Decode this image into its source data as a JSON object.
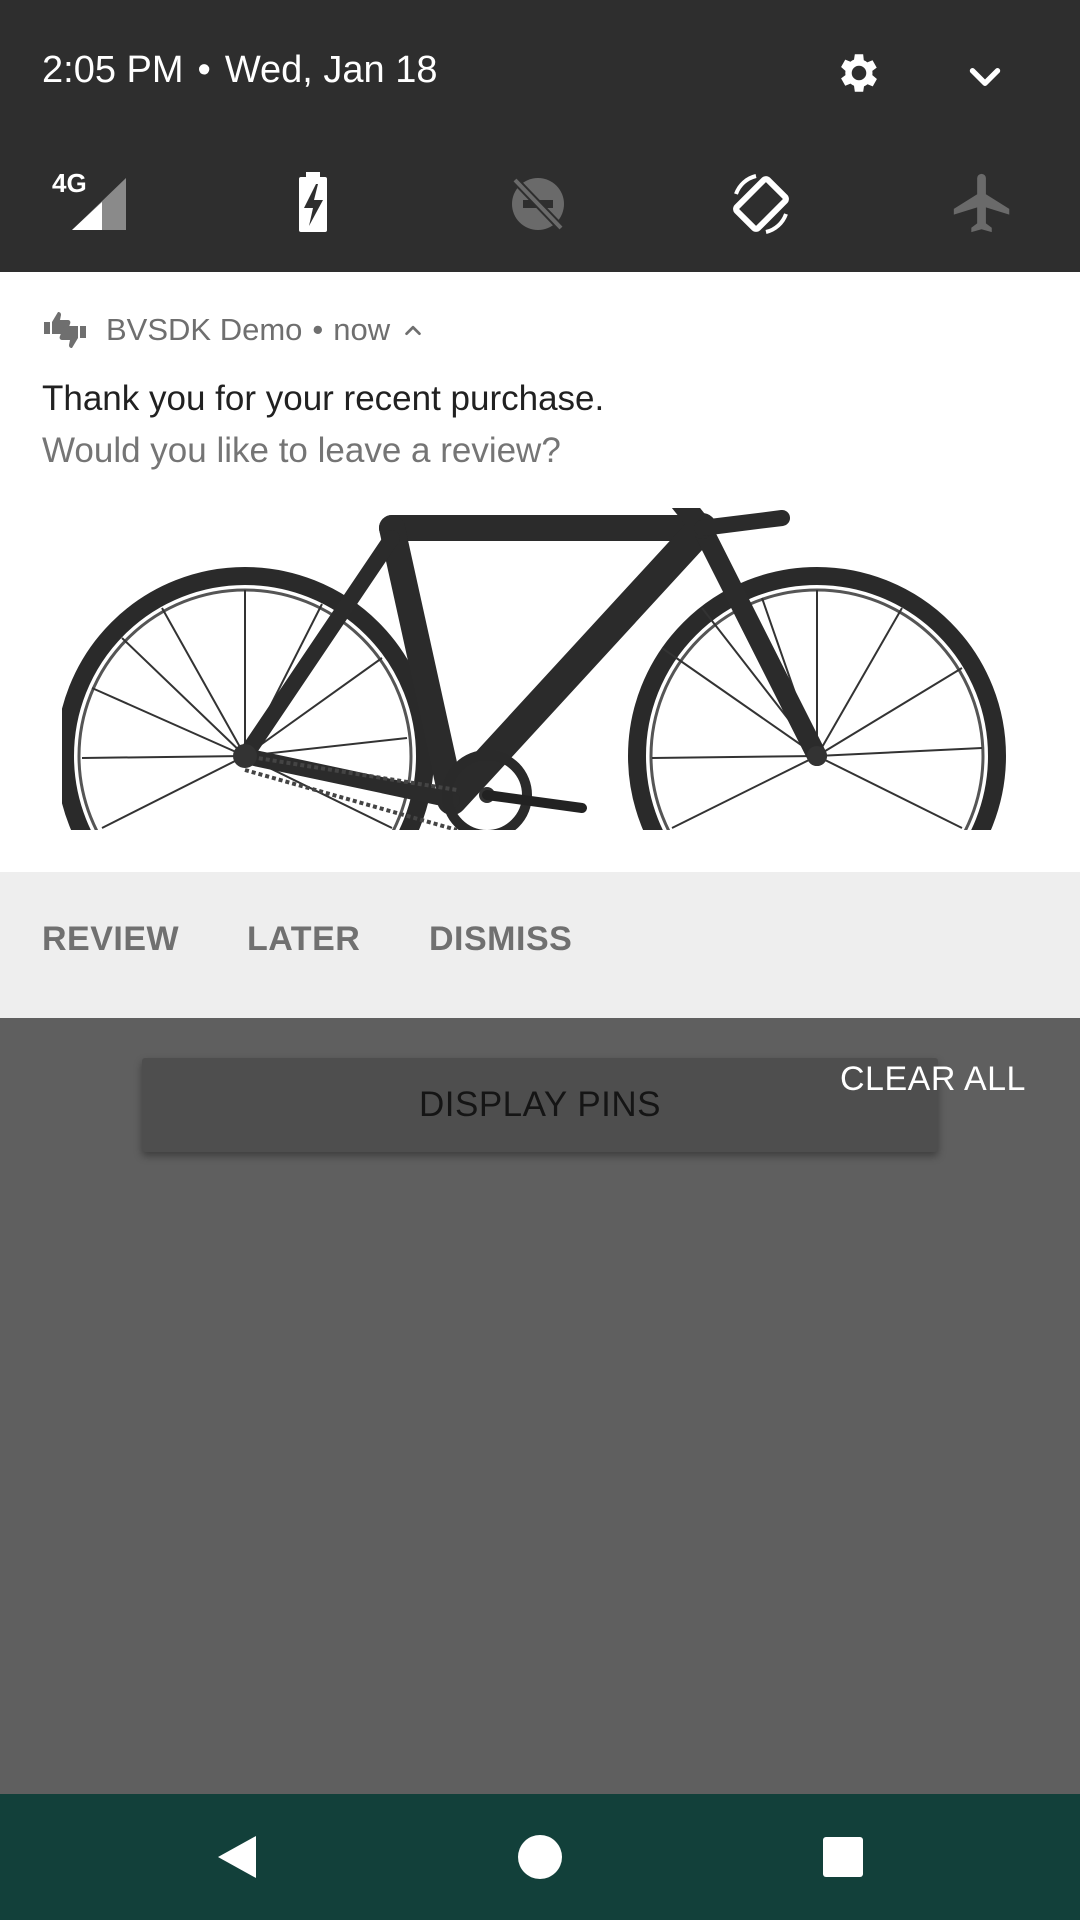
{
  "status": {
    "time": "2:05 PM",
    "date": "Wed, Jan 18",
    "separator": "•",
    "network_label": "4G"
  },
  "quick_settings": {
    "tiles": [
      {
        "icon": "signal-4g-icon"
      },
      {
        "icon": "battery-charging-icon"
      },
      {
        "icon": "do-not-disturb-off-icon"
      },
      {
        "icon": "auto-rotate-icon"
      },
      {
        "icon": "airplane-mode-icon"
      }
    ]
  },
  "notification": {
    "app_name": "BVSDK Demo",
    "separator": "•",
    "time": "now",
    "title": "Thank you for your recent purchase.",
    "text": "Would you like to leave a review?",
    "image_icon": "bicycle-image",
    "actions": {
      "review": "REVIEW",
      "later": "LATER",
      "dismiss": "DISMISS"
    }
  },
  "app": {
    "display_pins_label": "DISPLAY PINS",
    "clear_all_label": "CLEAR ALL"
  },
  "colors": {
    "shade": "#2e2e2e",
    "navbar": "#12403a",
    "scrim": "#5f5f5f"
  }
}
